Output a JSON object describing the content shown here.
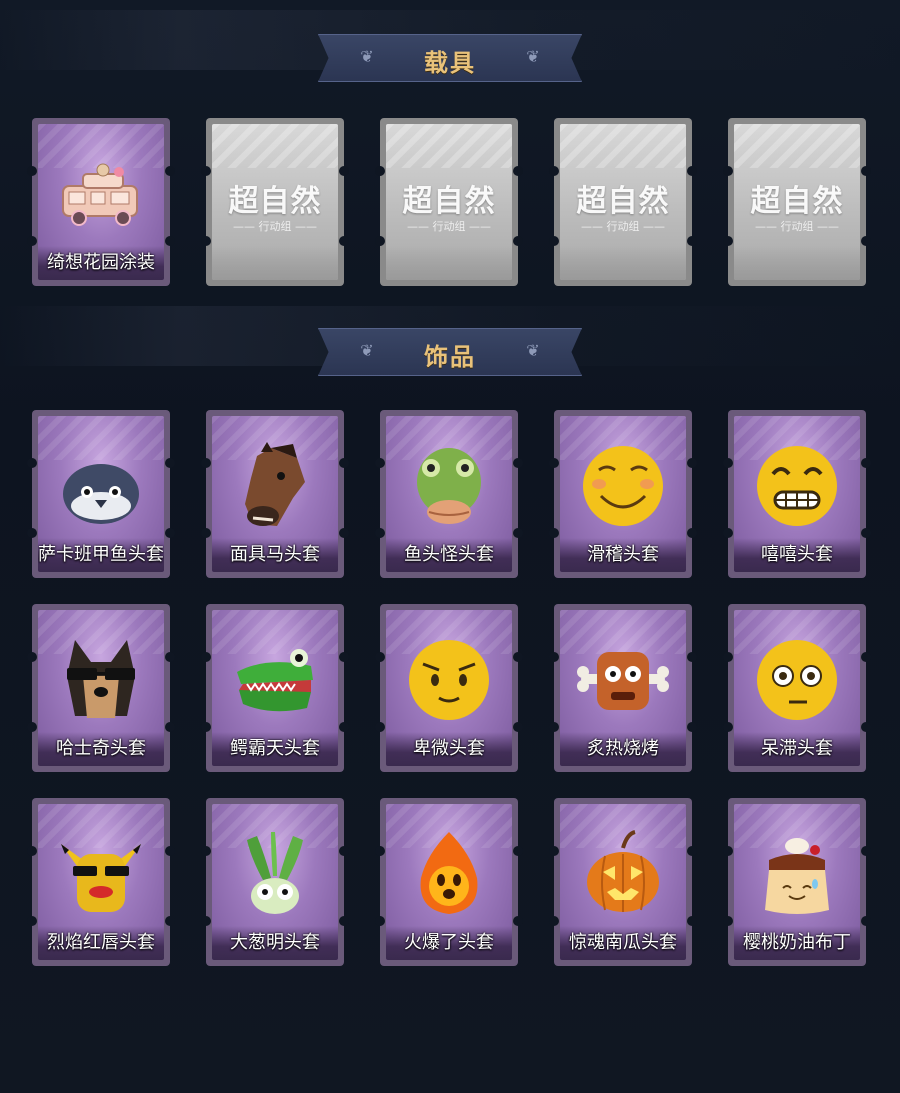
{
  "sections": [
    {
      "title": "载具"
    },
    {
      "title": "饰品"
    }
  ],
  "vehicles": [
    {
      "label": "绮想花园涂装",
      "icon": "rose-gold-van-icon",
      "locked": false
    },
    {
      "locked": true,
      "placeholder": "超自然",
      "placeholder_sub": "—— 行动组 ——"
    },
    {
      "locked": true,
      "placeholder": "超自然",
      "placeholder_sub": "—— 行动组 ——"
    },
    {
      "locked": true,
      "placeholder": "超自然",
      "placeholder_sub": "—— 行动组 ——"
    },
    {
      "locked": true,
      "placeholder": "超自然",
      "placeholder_sub": "—— 行动组 ——"
    }
  ],
  "accessories": [
    {
      "label": "萨卡班甲鱼头套",
      "icon": "fish-head-icon"
    },
    {
      "label": "面具马头套",
      "icon": "horse-mask-icon"
    },
    {
      "label": "鱼头怪头套",
      "icon": "fishman-head-icon"
    },
    {
      "label": "滑稽头套",
      "icon": "smirk-emoji-head-icon"
    },
    {
      "label": "嘻嘻头套",
      "icon": "grin-emoji-head-icon"
    },
    {
      "label": "哈士奇头套",
      "icon": "husky-head-icon"
    },
    {
      "label": "鳄霸天头套",
      "icon": "crocodile-head-icon"
    },
    {
      "label": "卑微头套",
      "icon": "humble-emoji-head-icon"
    },
    {
      "label": "炙热烧烤",
      "icon": "bbq-meat-head-icon"
    },
    {
      "label": "呆滞头套",
      "icon": "dazed-emoji-head-icon"
    },
    {
      "label": "烈焰红唇头套",
      "icon": "red-lips-head-icon"
    },
    {
      "label": "大葱明头套",
      "icon": "scallion-head-icon"
    },
    {
      "label": "火爆了头套",
      "icon": "fire-head-icon"
    },
    {
      "label": "惊魂南瓜头套",
      "icon": "pumpkin-head-icon"
    },
    {
      "label": "樱桃奶油布丁",
      "icon": "pudding-head-icon"
    }
  ],
  "colors": {
    "background": "#0f1622",
    "banner": "#2b3552",
    "banner_text": "#e9c27a",
    "card_purple": "#9c79bd",
    "card_locked": "#bdbdbd"
  }
}
